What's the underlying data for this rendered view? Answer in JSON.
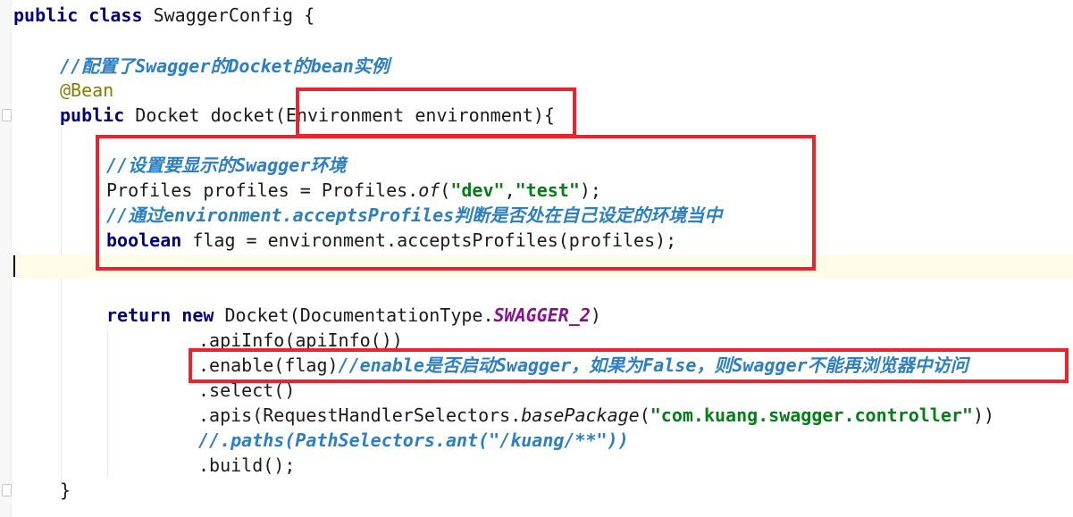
{
  "editor": {
    "lines": {
      "class_decl": {
        "kw_public": "public",
        "kw_class": "class",
        "class_name": "SwaggerConfig {"
      },
      "comment_bean": "//配置了Swagger的Docket的bean实例",
      "annotation": "@Bean",
      "method_decl": {
        "kw_public": "public",
        "text_before": "Docket docket(",
        "param": "Environment environment",
        "text_after": "){"
      },
      "comment_env": "//设置要显示的Swagger环境",
      "profiles_line": {
        "before": "Profiles profiles = Profiles.",
        "method": "of",
        "open": "(",
        "str_dev": "\"dev\"",
        "comma": ",",
        "str_test": "\"test\"",
        "close": ");"
      },
      "comment_accepts": "//通过environment.acceptsProfiles判断是否处在自己设定的环境当中",
      "flag_line": {
        "kw_boolean": "boolean",
        "rest": "flag = environment.acceptsProfiles(profiles);"
      },
      "return_line": {
        "kw_return": "return",
        "kw_new": "new",
        "before": "Docket(DocumentationType.",
        "field": "SWAGGER_2",
        "close": ")"
      },
      "api_info": ".apiInfo(apiInfo())",
      "enable_line": {
        "code": ".enable(flag)",
        "comment": "//enable是否启动Swagger，如果为False，则Swagger不能再浏览器中访问"
      },
      "select": ".select()",
      "apis_line": {
        "before": ".apis(RequestHandlerSelectors.",
        "method": "basePackage",
        "open": "(",
        "str": "\"com.kuang.swagger.controller\"",
        "close": "))"
      },
      "paths_comment": "//.paths(PathSelectors.ant(\"/kuang/**\"))",
      "build": ".build();",
      "closing_brace": "}"
    }
  },
  "colors": {
    "keyword": "#000080",
    "comment": "#2b7fc2",
    "string": "#067d17",
    "annotation": "#808000",
    "field": "#871094",
    "highlight_box": "#e8252e",
    "current_line": "#fffde7"
  }
}
